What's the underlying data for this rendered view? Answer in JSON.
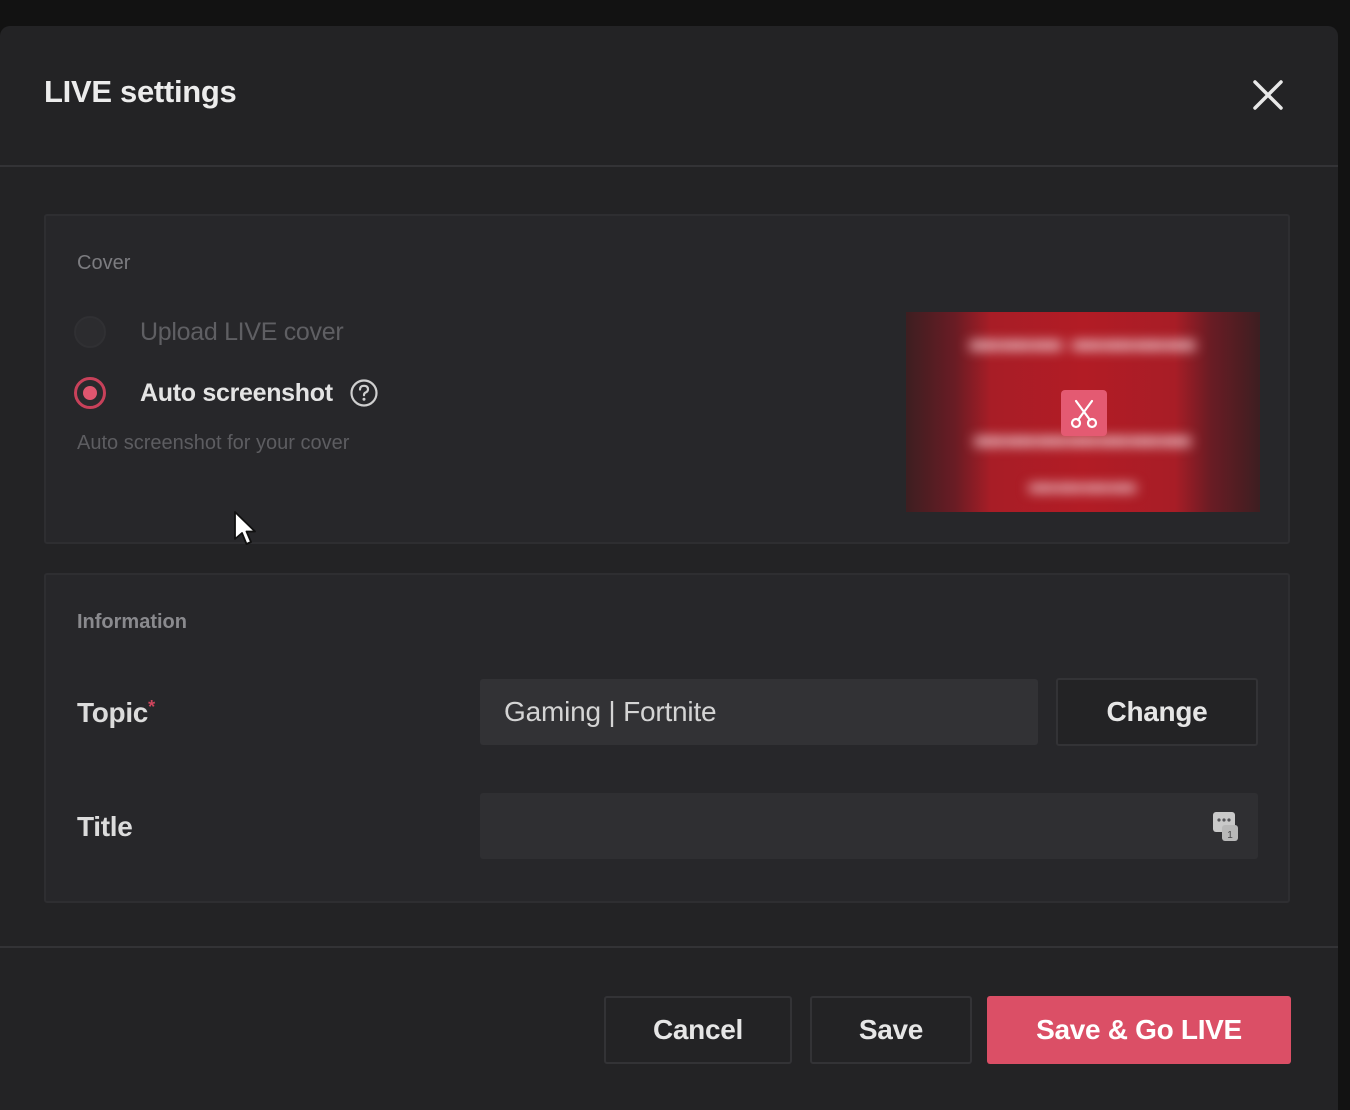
{
  "dialog": {
    "title": "LIVE settings"
  },
  "cover": {
    "section_label": "Cover",
    "options": [
      {
        "label": "Upload LIVE cover",
        "selected": false,
        "disabled": true
      },
      {
        "label": "Auto screenshot",
        "selected": true,
        "disabled": false
      }
    ],
    "hint": "Auto screenshot for your cover"
  },
  "information": {
    "section_label": "Information",
    "topic": {
      "label": "Topic",
      "required_mark": "*",
      "value": "Gaming | Fortnite",
      "change_label": "Change"
    },
    "title": {
      "label": "Title",
      "value": ""
    }
  },
  "footer": {
    "cancel_label": "Cancel",
    "save_label": "Save",
    "save_go_live_label": "Save & Go LIVE"
  },
  "icons": {
    "close": "close-icon",
    "help": "help-icon",
    "crop": "scissors-icon",
    "emoji": "sticker-icon"
  },
  "colors": {
    "accent": "#db4f66",
    "modal_bg": "#232325",
    "panel_bg": "#27272a",
    "input_bg": "#323235"
  }
}
